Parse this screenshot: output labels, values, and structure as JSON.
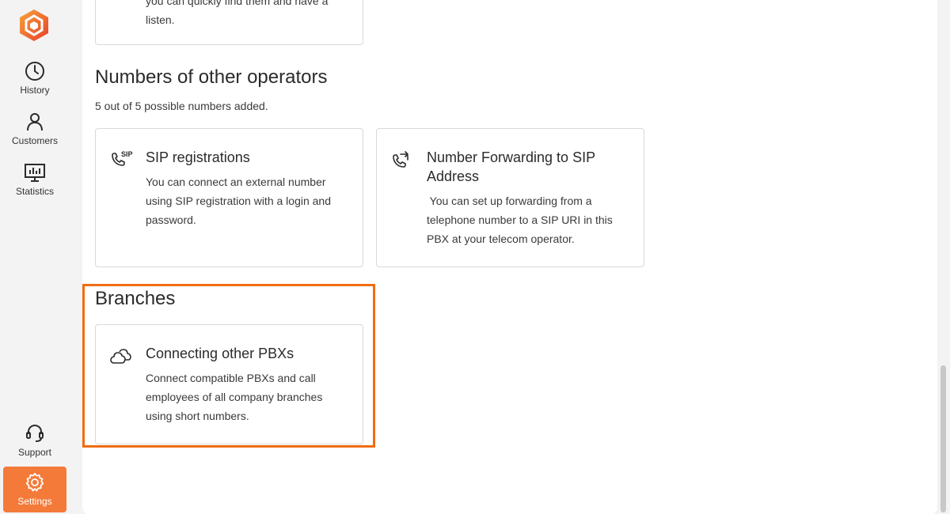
{
  "sidebar": {
    "items": [
      {
        "label": "History",
        "icon": "clock-icon"
      },
      {
        "label": "Customers",
        "icon": "person-icon"
      },
      {
        "label": "Statistics",
        "icon": "chart-icon"
      }
    ],
    "bottom_items": [
      {
        "label": "Support",
        "icon": "headset-icon"
      },
      {
        "label": "Settings",
        "icon": "gear-icon",
        "active": true
      }
    ],
    "accent_color": "#f47a3a"
  },
  "top_card": {
    "desc_partial": "you can quickly find them and have a",
    "desc_end": "listen."
  },
  "operators": {
    "title": "Numbers of other operators",
    "subtitle": "5 out of 5 possible numbers added.",
    "cards": [
      {
        "title": "SIP registrations",
        "desc_lines": [
          "You can connect an external number",
          "using SIP registration with a login and",
          "password."
        ],
        "icon": "phone-sip-icon",
        "icon_text": "SIP"
      },
      {
        "title_lines": [
          "Number Forwarding to SIP",
          "Address"
        ],
        "desc_lines": [
          " You can set up forwarding from a",
          "telephone number to a SIP URI in this",
          "PBX at your telecom operator."
        ],
        "icon": "phone-forward-icon"
      }
    ]
  },
  "branches": {
    "title": "Branches",
    "card": {
      "title": "Connecting other PBXs",
      "desc_lines": [
        "Connect compatible PBXs and call",
        "employees of all company branches",
        "using short numbers."
      ],
      "icon": "clouds-icon"
    },
    "highlight_color": "#f06c12"
  }
}
